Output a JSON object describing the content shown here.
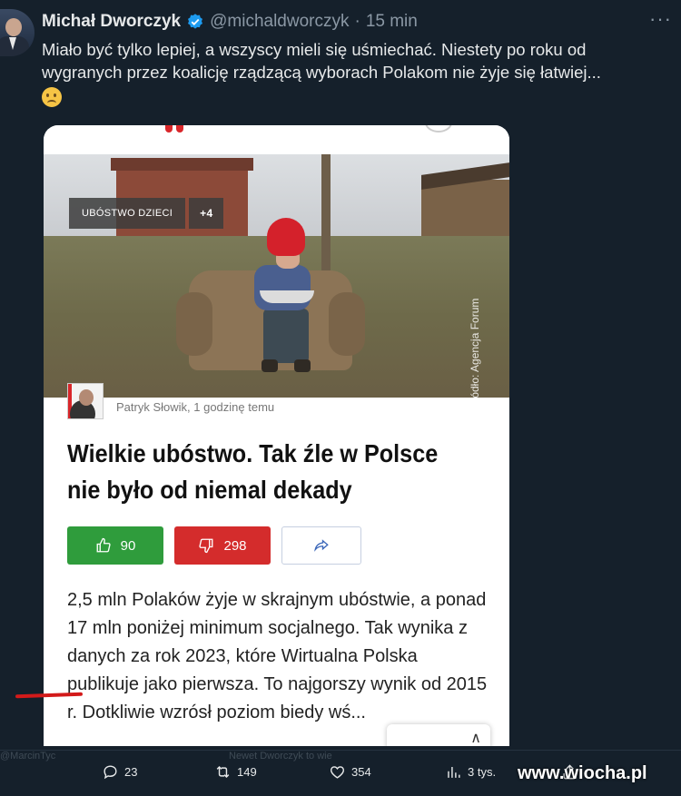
{
  "tweet": {
    "name": "Michał Dworczyk",
    "handle": "@michaldworczyk",
    "separator": "·",
    "time": "15 min",
    "text": "Miało być tylko lepiej, a wszyscy mieli się uśmiechać. Niestety po roku od wygranych przez koalicję rządzącą wyborach Polakom nie żyje się łatwiej...",
    "emoji": "worried-face-emoji"
  },
  "card": {
    "tags": [
      "UBÓSTWO DZIECI",
      "+4"
    ],
    "photo_source": "Źródło: Agencja Forum",
    "author": "Patryk Słowik, 1 godzinę temu",
    "headline": "Wielkie ubóstwo. Tak źle w Polsce nie było od niemal dekady",
    "votes": {
      "up": "90",
      "down": "298"
    },
    "body": "2,5 mln Polaków żyje w skrajnym ubóstwie, a ponad 17 mln poniżej minimum socjalnego. Tak wynika z danych za rok 2023, które Wirtualna Polska publikuje jako pierwsza. To najgorszy wynik od 2015 r. Dotkliwie wzrósł poziom biedy wś...",
    "pill_label": "∧"
  },
  "actions": {
    "replies": "23",
    "retweets": "149",
    "likes": "354",
    "views": "3 tys."
  },
  "ghost": {
    "left": "@MarcinTyc",
    "center": "Newet Dworczyk to wie"
  },
  "watermark": "www.wiocha.pl",
  "colors": {
    "background": "#15202b",
    "verified": "#1d9bf0",
    "up": "#2f9c3c",
    "down": "#d42c2c"
  }
}
